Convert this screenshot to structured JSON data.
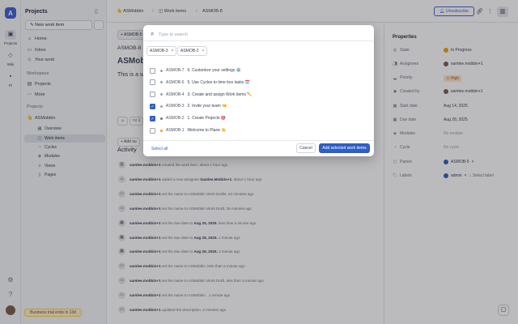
{
  "rail": {
    "logo_letter": "A",
    "projects_label": "Projects",
    "wiki_label": "Wiki",
    "pi_label": "Pi"
  },
  "sidebar": {
    "title": "Projects",
    "new_item_label": "New work item",
    "home": "Home",
    "inbox": "Inbox",
    "your_work": "Your work",
    "workspace_section": "Workspace",
    "workspace_projects": "Projects",
    "more": "More",
    "projects_section": "Projects",
    "project_name": "ASMobbin",
    "sub_items": [
      "Overview",
      "Work items",
      "Cycles",
      "Modules",
      "Views",
      "Pages"
    ],
    "trial_badge": "Business trial ends in 13d"
  },
  "topbar": {
    "crumb_project": "ASMobbin",
    "crumb_section": "Work items",
    "crumb_item": "ASMOB-8",
    "unsubscribe_label": "Unsubscribe"
  },
  "background": {
    "parent_chip": "ASMOB-5",
    "item_id": "ASMOB-8",
    "item_title": "ASMob",
    "description_start": "This is a w",
    "reaction": "1",
    "add_label": "Add su"
  },
  "activity": {
    "title": "Activity",
    "entries": [
      {
        "user": "samlee.mobbin+1",
        "text": "created the work item.",
        "time": "about 1 hour ago"
      },
      {
        "user": "samlee.mobbin+1",
        "text": "added a new assignee",
        "target": "Samlee.Mobbin+1.",
        "time": "about 1 hour ago"
      },
      {
        "user": "samlee.mobbin+1",
        "text": "set the name to ASMobbin Work Drafts.",
        "time": "24 minutes ago"
      },
      {
        "user": "samlee.mobbin+1",
        "text": "set the name to ASMobbin Work Draft.",
        "time": "25 minutes ago"
      },
      {
        "user": "samlee.mobbin+1",
        "text": "set the due date to",
        "target": "Aug 25, 2025.",
        "time": "less than a minute ago"
      },
      {
        "user": "samlee.mobbin+1",
        "text": "set the due date to",
        "target": "Aug 28, 2025.",
        "time": "1 minute ago"
      },
      {
        "user": "samlee.mobbin+1",
        "text": "set the due date to",
        "target": "Aug 28, 2025.",
        "time": "1 minute ago"
      },
      {
        "user": "samlee.mobbin+1",
        "text": "set the name to ASMobbin.",
        "time": "less than a minute ago"
      },
      {
        "user": "samlee.mobbin+1",
        "text": "set the name to ASMobbin Work Draft.",
        "time": "less than a minute ago"
      },
      {
        "user": "samlee.mobbin+1",
        "text": "set the name to ASMobbin .",
        "time": "1 minute ago"
      },
      {
        "user": "samlee.mobbin+1",
        "text": "updated the description.",
        "time": "2 minutes ago"
      }
    ]
  },
  "properties": {
    "heading": "Properties",
    "rows": [
      {
        "label": "State",
        "value": "In Progress"
      },
      {
        "label": "Assignees",
        "value": "samlee.mobbin+1"
      },
      {
        "label": "Priority",
        "value": "High"
      },
      {
        "label": "Created by",
        "value": "samlee.mobbin+1"
      },
      {
        "label": "Start date",
        "value": "Aug 14, 2025"
      },
      {
        "label": "Due date",
        "value": "Aug 28, 2025"
      },
      {
        "label": "Modules",
        "value": "No module"
      },
      {
        "label": "Cycle",
        "value": "No cycle"
      },
      {
        "label": "Parent",
        "value": "ASMOB-5"
      },
      {
        "label": "Labels",
        "value": "admin",
        "extra": "Select label"
      }
    ]
  },
  "modal": {
    "search_placeholder": "Type to search",
    "selected_chips": [
      "ASMOB-3",
      "ASMOB-2"
    ],
    "items": [
      {
        "id": "ASMOB-7",
        "title": "6. Customize your settings ⚙️",
        "checked": false,
        "state": "backlog"
      },
      {
        "id": "ASMOB-6",
        "title": "5. Use Cycles to time box tasks 🗓️",
        "checked": false,
        "state": "backlog"
      },
      {
        "id": "ASMOB-4",
        "title": "3. Create and assign Work items ✏️",
        "checked": false,
        "state": "backlog"
      },
      {
        "id": "ASMOB-3",
        "title": "2. Invite your team 🤜",
        "checked": true,
        "state": "backlog"
      },
      {
        "id": "ASMOB-2",
        "title": "1. Create Projects 🎯",
        "checked": true,
        "state": "todo"
      },
      {
        "id": "ASMOB-1",
        "title": "Welcome to Plane 👋",
        "checked": false,
        "state": "progress"
      }
    ],
    "select_all_label": "Select all",
    "cancel_label": "Cancel",
    "add_label": "Add selected work items"
  },
  "colors": {
    "accent": "#2f5fc4",
    "brand": "#3f5fd4",
    "trial_bg": "#fef3c7",
    "priority_high": "#b45309",
    "in_progress": "#f59e0b"
  }
}
